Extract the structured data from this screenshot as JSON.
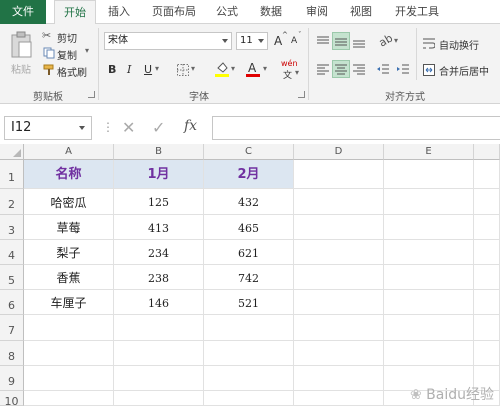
{
  "tabs": [
    {
      "label": "文件"
    },
    {
      "label": "开始"
    },
    {
      "label": "插入"
    },
    {
      "label": "页面布局"
    },
    {
      "label": "公式"
    },
    {
      "label": "数据"
    },
    {
      "label": "审阅"
    },
    {
      "label": "视图"
    },
    {
      "label": "开发工具"
    }
  ],
  "clipboard": {
    "paste": "粘贴",
    "cut": "剪切",
    "copy": "复制",
    "format_painter": "格式刷",
    "group_label": "剪贴板"
  },
  "font": {
    "name": "宋体",
    "size": "11",
    "bold": "B",
    "italic": "I",
    "underline": "U",
    "grow": "A",
    "shrink": "A",
    "font_color_letter": "A",
    "wen": "wén",
    "group_label": "字体",
    "font_color": "#e00000",
    "highlight_color": "#ffff00"
  },
  "alignment": {
    "wrap_text": "自动换行",
    "merge_center": "合并后居中",
    "group_label": "对齐方式"
  },
  "formula_bar": {
    "name_box": "I12",
    "cancel": "✕",
    "enter": "✓",
    "fx": "fx",
    "formula": ""
  },
  "columns": [
    "A",
    "B",
    "C",
    "D",
    "E"
  ],
  "rows": [
    "1",
    "2",
    "3",
    "4",
    "5",
    "6",
    "7",
    "8",
    "9",
    "10"
  ],
  "table": {
    "headers": [
      "名称",
      "1月",
      "2月"
    ],
    "rows": [
      [
        "哈密瓜",
        "125",
        "432"
      ],
      [
        "草莓",
        "413",
        "465"
      ],
      [
        "梨子",
        "234",
        "621"
      ],
      [
        "香蕉",
        "238",
        "742"
      ],
      [
        "车厘子",
        "146",
        "521"
      ]
    ]
  },
  "watermark": "Baidu经验",
  "colors": {
    "accent": "#217346",
    "header_fill": "#dce6f1",
    "header_text": "#7030a0"
  }
}
